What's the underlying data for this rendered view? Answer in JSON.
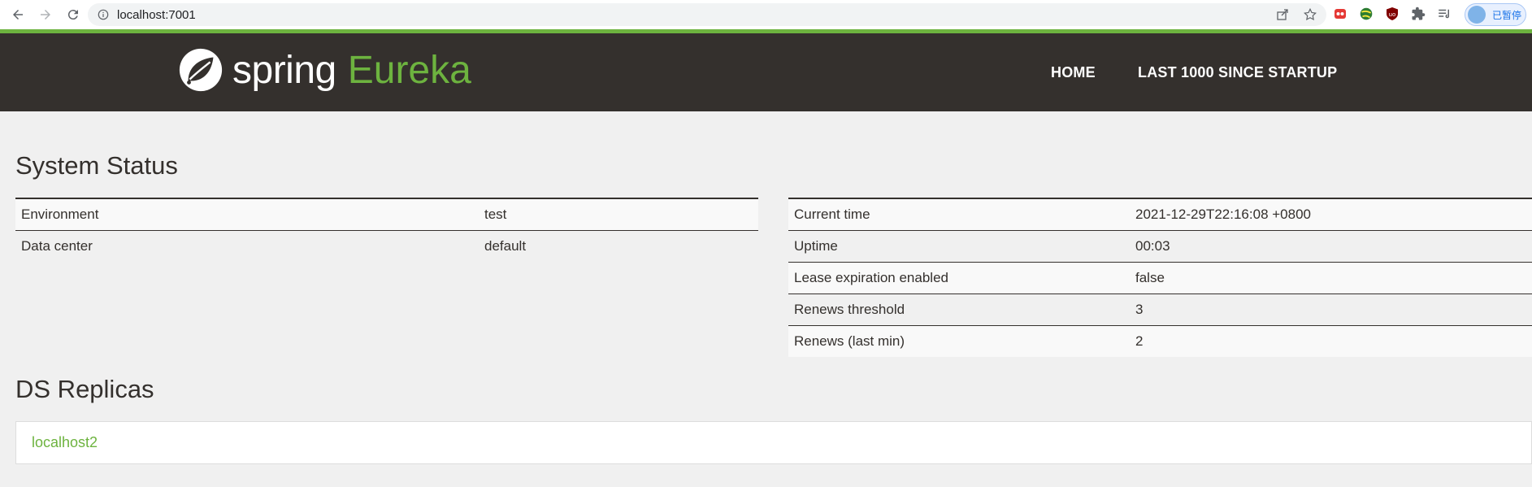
{
  "browser": {
    "url": "localhost:7001",
    "profile_label": "已暂停"
  },
  "navbar": {
    "brand_spring": "spring",
    "brand_eureka": "Eureka",
    "home": "HOME",
    "last1000": "LAST 1000 SINCE STARTUP"
  },
  "system_status": {
    "title": "System Status",
    "left": [
      {
        "label": "Environment",
        "value": "test"
      },
      {
        "label": "Data center",
        "value": "default"
      }
    ],
    "right": [
      {
        "label": "Current time",
        "value": "2021-12-29T22:16:08 +0800"
      },
      {
        "label": "Uptime",
        "value": "00:03"
      },
      {
        "label": "Lease expiration enabled",
        "value": "false"
      },
      {
        "label": "Renews threshold",
        "value": "3"
      },
      {
        "label": "Renews (last min)",
        "value": "2"
      }
    ]
  },
  "ds_replicas": {
    "title": "DS Replicas",
    "items": [
      "localhost2"
    ]
  },
  "colors": {
    "accent": "#6db33f",
    "navbar_bg": "#34302d",
    "page_bg": "#f0f0f0"
  }
}
